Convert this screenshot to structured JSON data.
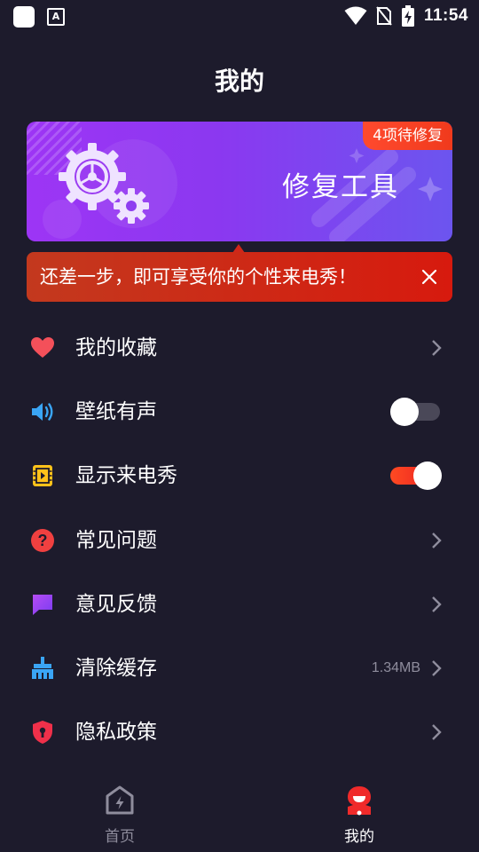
{
  "status_bar": {
    "time": "11:54",
    "notification_icon": "A"
  },
  "page": {
    "title": "我的"
  },
  "banner": {
    "badge": "4项待修复",
    "title": "修复工具",
    "accent": "#9d35f5"
  },
  "tip": {
    "text": "还差一步，即可享受你的个性来电秀！"
  },
  "menu": {
    "favorites": {
      "label": "我的收藏"
    },
    "wallpaper_sound": {
      "label": "壁纸有声",
      "enabled": false
    },
    "caller_show": {
      "label": "显示来电秀",
      "enabled": true
    },
    "faq": {
      "label": "常见问题"
    },
    "feedback": {
      "label": "意见反馈"
    },
    "clear_cache": {
      "label": "清除缓存",
      "value": "1.34MB"
    },
    "privacy": {
      "label": "隐私政策"
    }
  },
  "tabbar": {
    "home": {
      "label": "首页",
      "active": false
    },
    "mine": {
      "label": "我的",
      "active": true
    }
  },
  "colors": {
    "background": "#1d1b2c",
    "accent_red": "#e81d22",
    "inactive": "#8f8d9d"
  }
}
